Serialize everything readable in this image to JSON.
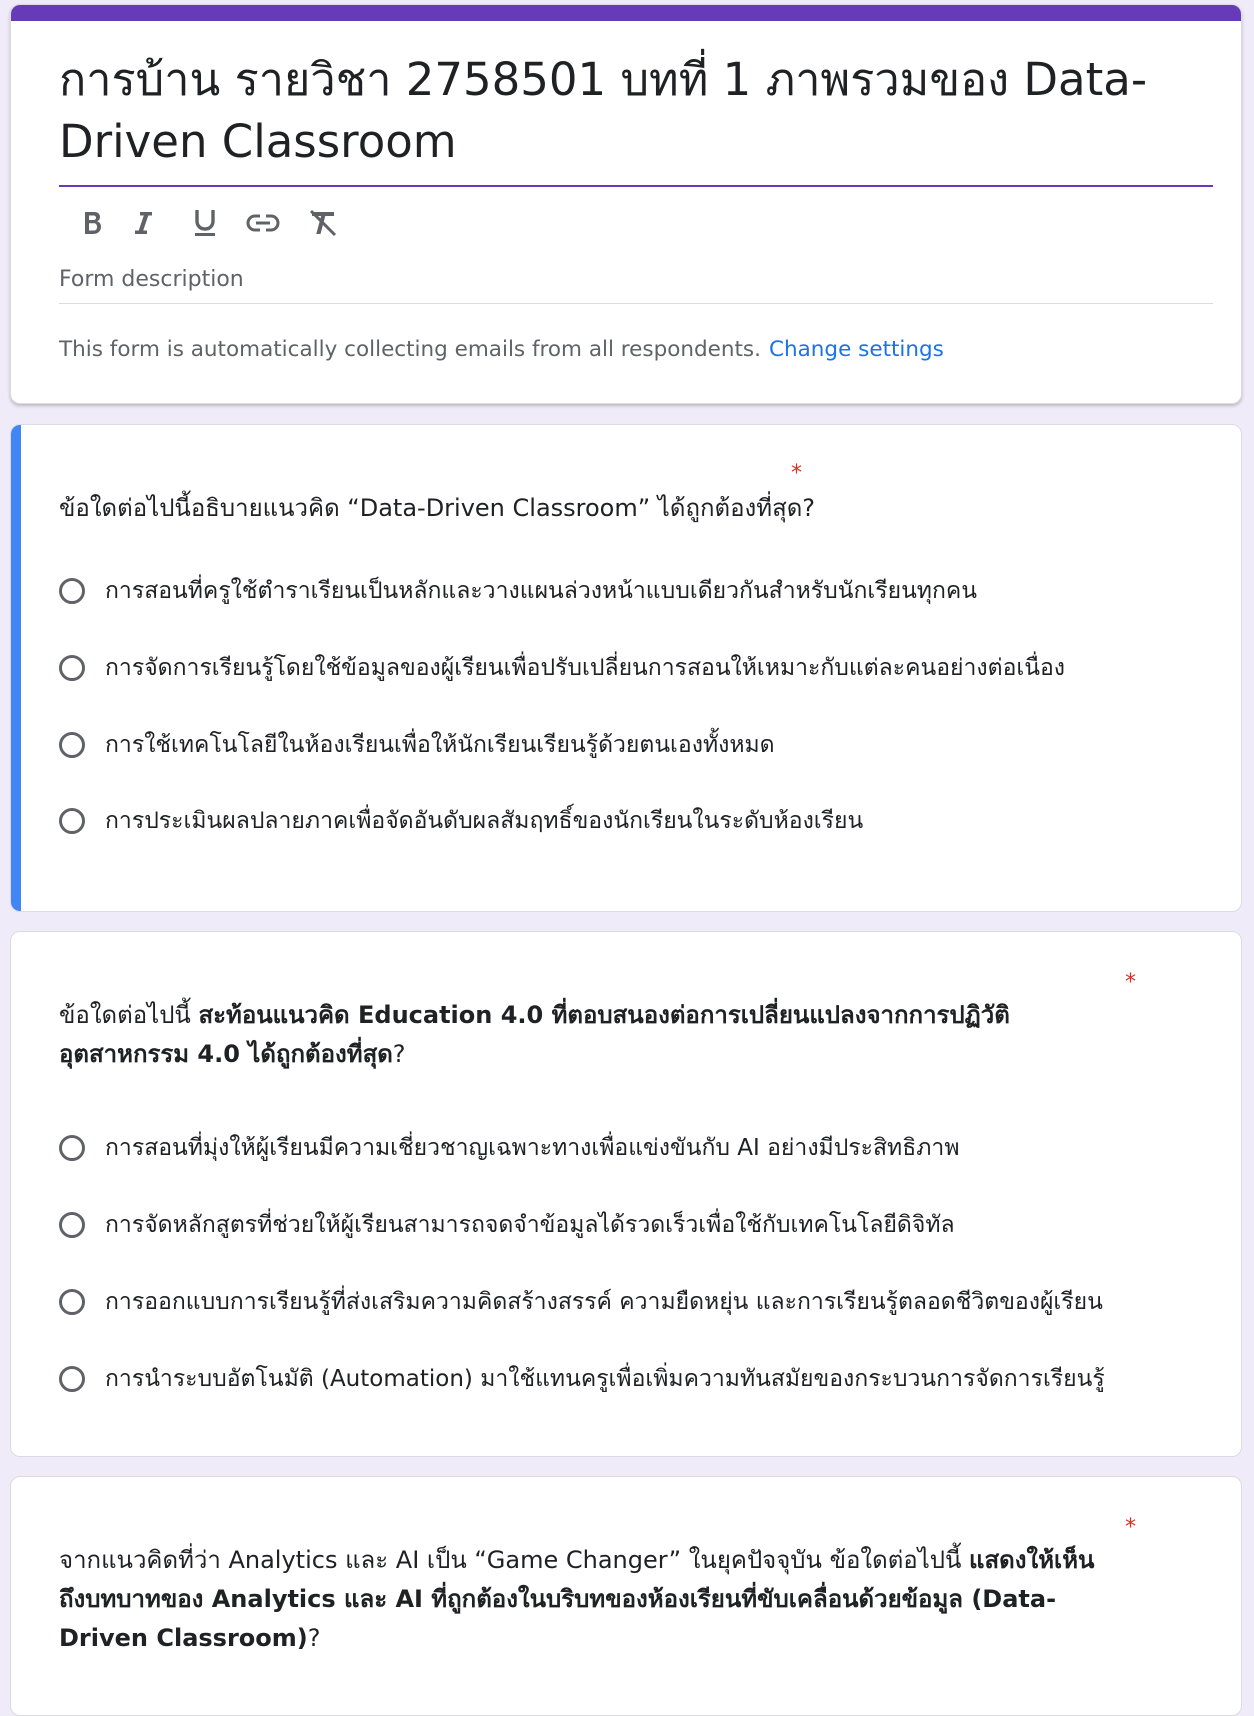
{
  "header": {
    "title": "การบ้าน รายวิชา 2758501 บทที่ 1 ภาพรวมของ Data-Driven Classroom",
    "toolbar": {
      "bold_icon": "bold-icon",
      "italic_icon": "italic-icon",
      "underline_icon": "underline-icon",
      "link_icon": "link-icon",
      "clear_format_icon": "clear-formatting-icon"
    },
    "description_placeholder": "Form description",
    "email_note": "This form is automatically collecting emails from all respondents.",
    "change_settings": "Change settings"
  },
  "colors": {
    "theme": "#673ab7",
    "active_indicator": "#4285f4",
    "background": "#f0ebf8",
    "required": "#d93025",
    "link": "#1a73e8"
  },
  "questions": [
    {
      "required_marker": "*",
      "title": "ข้อใดต่อไปนี้อธิบายแนวคิด “Data-Driven Classroom” ได้ถูกต้องที่สุด?",
      "options": [
        "การสอนที่ครูใช้ตำราเรียนเป็นหลักและวางแผนล่วงหน้าแบบเดียวกันสำหรับนักเรียนทุกคน",
        "การจัดการเรียนรู้โดยใช้ข้อมูลของผู้เรียนเพื่อปรับเปลี่ยนการสอนให้เหมาะกับแต่ละคนอย่างต่อเนื่อง",
        "การใช้เทคโนโลยีในห้องเรียนเพื่อให้นักเรียนเรียนรู้ด้วยตนเองทั้งหมด",
        "การประเมินผลปลายภาคเพื่อจัดอันดับผลสัมฤทธิ์ของนักเรียนในระดับห้องเรียน"
      ]
    },
    {
      "required_marker": "*",
      "title_parts": [
        "ข้อใดต่อไปนี้ ",
        "สะท้อนแนวคิด Education 4.0 ที่ตอบสนองต่อการเปลี่ยนแปลงจากการปฏิวัติอุตสาหกรรม 4.0 ได้ถูกต้องที่สุด",
        "?"
      ],
      "options": [
        "การสอนที่มุ่งให้ผู้เรียนมีความเชี่ยวชาญเฉพาะทางเพื่อแข่งขันกับ AI อย่างมีประสิทธิภาพ",
        "การจัดหลักสูตรที่ช่วยให้ผู้เรียนสามารถจดจำข้อมูลได้รวดเร็วเพื่อใช้กับเทคโนโลยีดิจิทัล",
        "การออกแบบการเรียนรู้ที่ส่งเสริมความคิดสร้างสรรค์ ความยืดหยุ่น และการเรียนรู้ตลอดชีวิตของผู้เรียน",
        "การนำระบบอัตโนมัติ (Automation) มาใช้แทนครูเพื่อเพิ่มความทันสมัยของกระบวนการจัดการเรียนรู้"
      ]
    },
    {
      "required_marker": "*",
      "title_parts": [
        "จากแนวคิดที่ว่า Analytics และ AI เป็น “Game Changer” ในยุคปัจจุบัน ข้อใดต่อไปนี้ ",
        "แสดงให้เห็นถึงบทบาทของ Analytics และ AI ที่ถูกต้องในบริบทของห้องเรียนที่ขับเคลื่อนด้วยข้อมูล (Data-Driven Classroom)",
        "?"
      ]
    }
  ]
}
